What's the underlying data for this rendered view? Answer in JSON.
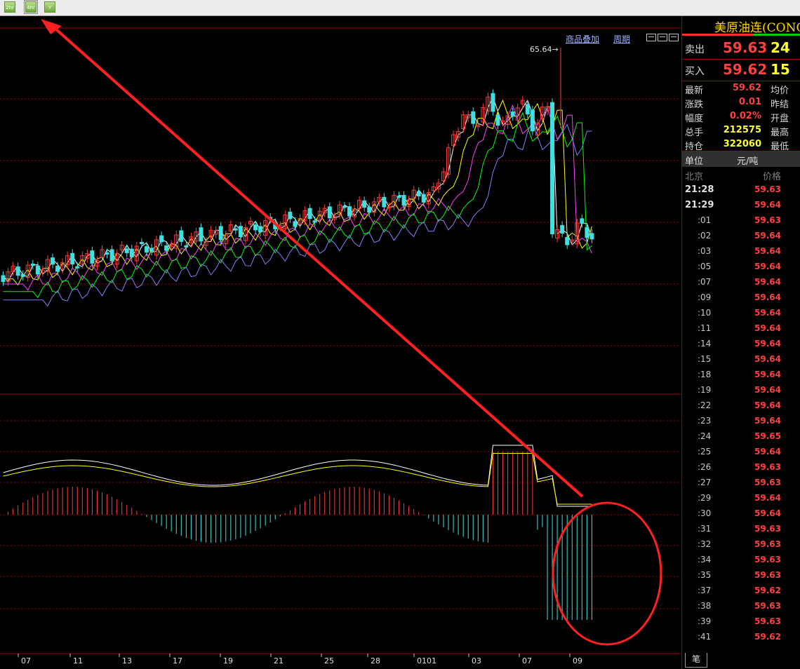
{
  "toolbar": {
    "buttons": [
      {
        "icon": "2hr-chart-icon",
        "label": "2hr"
      },
      {
        "icon": "4hr-chart-icon",
        "label": "4hr"
      },
      {
        "icon": "filter-icon",
        "label": "Y"
      }
    ]
  },
  "chart": {
    "menu": {
      "overlay": "商品叠加",
      "period": "周期"
    },
    "high_label": "65.64→",
    "x_labels": [
      "07",
      "11",
      "13",
      "17",
      "19",
      "21",
      "25",
      "28",
      "0101",
      "03",
      "07",
      "09"
    ],
    "colors": {
      "up": "#ff3c3c",
      "down": "#40e0e0",
      "ma5": "#ffffff",
      "ma10": "#ffff00",
      "ma20": "#ff40ff",
      "ma30": "#00ff00",
      "ma60": "#8080ff",
      "annotation": "#ff2020",
      "grid": "#a00000"
    },
    "annotation": {
      "arrow": "red-arrow",
      "circle": "red-circle"
    }
  },
  "side": {
    "title": "美原油连(CONC)",
    "sell": {
      "label": "卖出",
      "price": "59.63",
      "volume": "24"
    },
    "buy": {
      "label": "买入",
      "price": "59.62",
      "volume": "15"
    },
    "stats": [
      {
        "key": "最新",
        "value": "59.62",
        "color": "#ff4040",
        "key2": "均价"
      },
      {
        "key": "涨跌",
        "value": "0.01",
        "color": "#ff4040",
        "key2": "昨结"
      },
      {
        "key": "幅度",
        "value": "0.02%",
        "color": "#ff4040",
        "key2": "开盘"
      },
      {
        "key": "总手",
        "value": "212575",
        "color": "#ffff30",
        "key2": "最高"
      },
      {
        "key": "持仓",
        "value": "322060",
        "color": "#ffff30",
        "key2": "最低"
      }
    ],
    "unit": {
      "key": "单位",
      "value": "元/吨"
    },
    "table_header": {
      "time": "北京",
      "price": "价格"
    },
    "ticks": [
      {
        "time": "21:28",
        "price": "59.63"
      },
      {
        "time": "21:29",
        "price": "59.64"
      },
      {
        "time": ":01",
        "price": "59.63"
      },
      {
        "time": ":02",
        "price": "59.64"
      },
      {
        "time": ":03",
        "price": "59.64"
      },
      {
        "time": ":05",
        "price": "59.64"
      },
      {
        "time": ":07",
        "price": "59.64"
      },
      {
        "time": ":09",
        "price": "59.64"
      },
      {
        "time": ":10",
        "price": "59.64"
      },
      {
        "time": ":11",
        "price": "59.64"
      },
      {
        "time": ":14",
        "price": "59.64"
      },
      {
        "time": ":15",
        "price": "59.64"
      },
      {
        "time": ":18",
        "price": "59.64"
      },
      {
        "time": ":19",
        "price": "59.64"
      },
      {
        "time": ":22",
        "price": "59.64"
      },
      {
        "time": ":23",
        "price": "59.64"
      },
      {
        "time": ":24",
        "price": "59.65"
      },
      {
        "time": ":25",
        "price": "59.64"
      },
      {
        "time": ":26",
        "price": "59.63"
      },
      {
        "time": ":27",
        "price": "59.63"
      },
      {
        "time": ":29",
        "price": "59.64"
      },
      {
        "time": ":30",
        "price": "59.64"
      },
      {
        "time": ":31",
        "price": "59.63"
      },
      {
        "time": ":32",
        "price": "59.63"
      },
      {
        "time": ":34",
        "price": "59.63"
      },
      {
        "time": ":35",
        "price": "59.63"
      },
      {
        "time": ":37",
        "price": "59.62"
      },
      {
        "time": ":38",
        "price": "59.63"
      },
      {
        "time": ":39",
        "price": "59.63"
      },
      {
        "time": ":41",
        "price": "59.62"
      }
    ],
    "bottom_tab": "笔"
  }
}
